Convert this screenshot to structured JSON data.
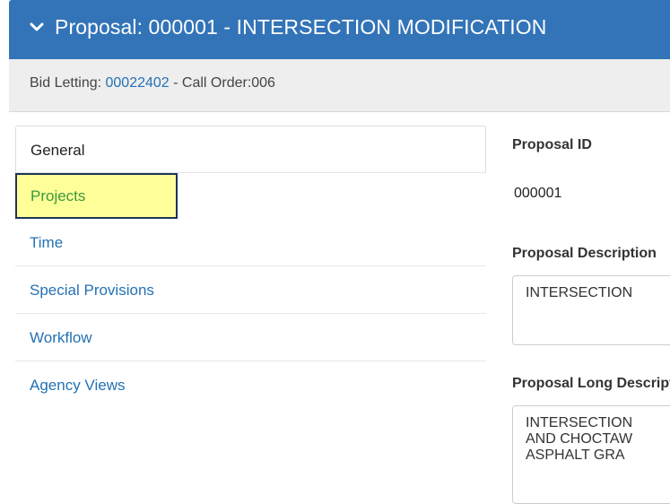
{
  "header": {
    "title": "Proposal: 000001 - INTERSECTION MODIFICATION"
  },
  "subbar": {
    "bid_letting_label": "Bid Letting: ",
    "bid_letting_value": "00022402",
    "call_order": " - Call Order:006"
  },
  "nav": {
    "items": [
      {
        "label": "General"
      },
      {
        "label": "Projects"
      },
      {
        "label": "Time"
      },
      {
        "label": "Special Provisions"
      },
      {
        "label": "Workflow"
      },
      {
        "label": "Agency Views"
      }
    ]
  },
  "details": {
    "proposal_id_label": "Proposal ID",
    "proposal_id_value": "000001",
    "description_label": "Proposal Description",
    "description_value": "INTERSECTION",
    "long_label": "Proposal Long Description",
    "long_lines": [
      "INTERSECTION",
      "AND CHOCTAW",
      "ASPHALT GRA"
    ]
  },
  "colors": {
    "header_bg": "#3374b8",
    "link": "#2471b3",
    "focus_highlight": "#ffff99",
    "focus_border": "#1d3557"
  }
}
